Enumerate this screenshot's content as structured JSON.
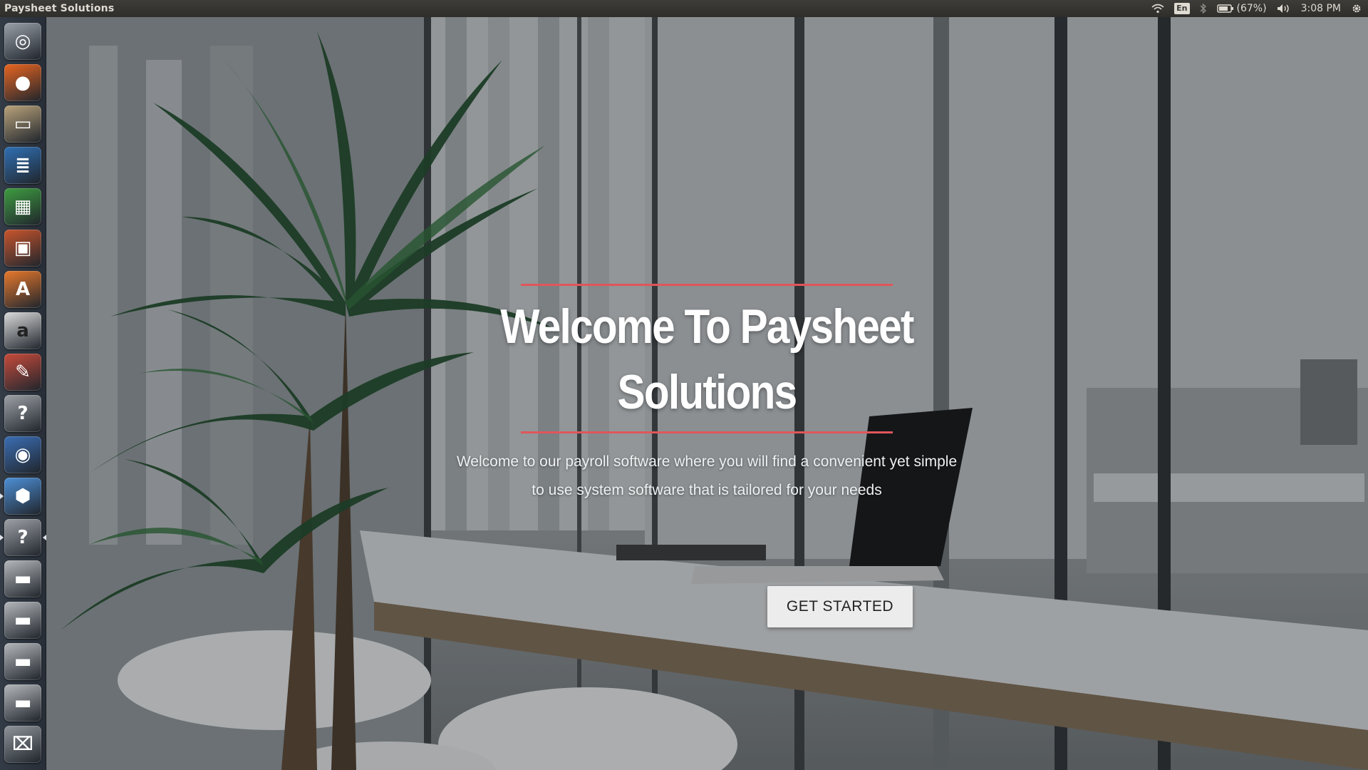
{
  "top_panel": {
    "window_title": "Paysheet Solutions",
    "keyboard_layout": "En",
    "battery_percent": "(67%)",
    "clock": "3:08 PM",
    "icons": [
      "wifi-icon",
      "keyboard-layout-icon",
      "bluetooth-icon",
      "battery-icon",
      "volume-icon",
      "settings-gear-icon"
    ]
  },
  "launcher": {
    "items": [
      {
        "name": "ubuntu-dash-icon",
        "color": "#9aa0a8"
      },
      {
        "name": "firefox-icon",
        "color": "#e8641f"
      },
      {
        "name": "files-icon",
        "color": "#b9a27a"
      },
      {
        "name": "libreoffice-writer-icon",
        "color": "#2f6fb3"
      },
      {
        "name": "libreoffice-calc-icon",
        "color": "#3d9b3f"
      },
      {
        "name": "libreoffice-impress-icon",
        "color": "#c8542b"
      },
      {
        "name": "software-center-icon",
        "color": "#e8782b"
      },
      {
        "name": "amazon-icon",
        "color": "#d9d9d9"
      },
      {
        "name": "system-settings-icon",
        "color": "#c74a3a"
      },
      {
        "name": "help-icon",
        "color": "#9da1a6"
      },
      {
        "name": "blender-icon",
        "color": "#3a6db3"
      },
      {
        "name": "virtualbox-icon",
        "color": "#4d8fd6"
      },
      {
        "name": "unknown-app-icon",
        "color": "#9da1a6"
      },
      {
        "name": "drive-icon",
        "color": "#b4b7ba"
      },
      {
        "name": "drive-icon",
        "color": "#b4b7ba"
      },
      {
        "name": "drive-icon",
        "color": "#b4b7ba"
      },
      {
        "name": "drive-icon",
        "color": "#b4b7ba"
      },
      {
        "name": "trash-icon",
        "color": "#8f9499"
      }
    ]
  },
  "hero": {
    "title": "Welcome To Paysheet Solutions",
    "subtitle": "Welcome to our payroll software where you will find a convenient yet simple to use system software that is tailored for your needs",
    "cta_label": "GET STARTED",
    "accent_color": "#e0565a"
  }
}
